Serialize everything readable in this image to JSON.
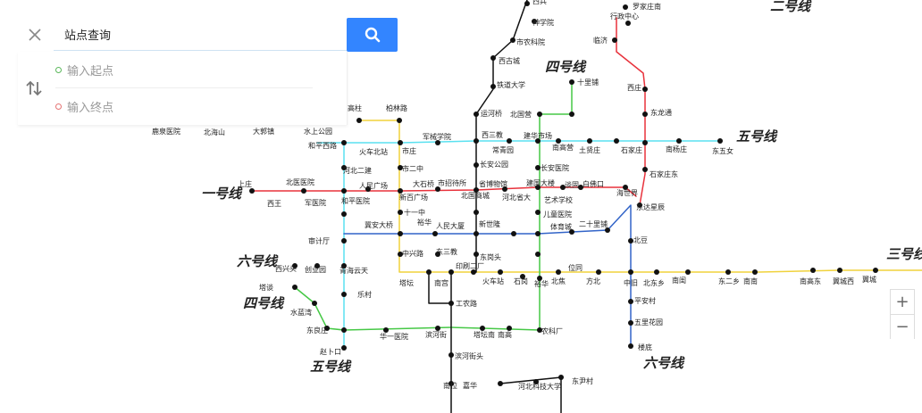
{
  "search": {
    "title": "站点查询",
    "start_placeholder": "输入起点",
    "end_placeholder": "输入终点"
  },
  "icons": {
    "close": "close-icon",
    "search": "search-icon",
    "swap": "swap-icon"
  },
  "colors": {
    "search_button": "#3385ff",
    "line1": "#e8323c",
    "line2": "#e83c3c",
    "line3": "#f0d23c",
    "line4": "#46c846",
    "line5": "#5ae1f0",
    "line6": "#3264c8"
  },
  "line_names": [
    "一号线",
    "二号线",
    "三号线",
    "四号线",
    "五号线",
    "五号线",
    "六号线",
    "六号线",
    "四号线"
  ],
  "stations": [
    "西兵",
    "神学院",
    "市农科院",
    "罗家庄南",
    "行政中心",
    "临济",
    "西古城",
    "十里铺",
    "铁道大学",
    "西庄",
    "运河桥",
    "北国营",
    "东龙通",
    "高柱",
    "柏林路",
    "二号线",
    "一号线",
    "三号线",
    "五号线",
    "鹿泉医院",
    "北海山",
    "大郭镇",
    "水上公园",
    "和平西路",
    "火车北站",
    "市庄",
    "军械学院",
    "西三教",
    "常青园",
    "建华市场",
    "南高营",
    "土贤庄",
    "石家庄",
    "南杨庄",
    "东五女",
    "河北二建",
    "长安公园",
    "市二中",
    "长安医院",
    "石家庄东",
    "上庄",
    "西王",
    "军医院",
    "北医医院",
    "和平医院",
    "人民广场",
    "大石桥",
    "新百广场",
    "市招待所",
    "北国商城",
    "河北省大",
    "省博物馆",
    "谈固",
    "建国大楼",
    "海世界",
    "白佛口",
    "艺术学校",
    "东达星辰",
    "十一中",
    "儿童医院",
    "牡丹院",
    "冀安大桥",
    "裕华",
    "人民大厦",
    "新世隆",
    "体育城",
    "二十里铺",
    "东三教",
    "北豆",
    "审计厅",
    "六号线",
    "四号线",
    "西兴头",
    "创业园",
    "青海云天",
    "中兴路",
    "东岗头",
    "孙村",
    "白佛",
    "印刷二厂",
    "塔坛",
    "南宫",
    "火车站",
    "金街村",
    "石岗",
    "裕华",
    "北焦",
    "位同",
    "方北",
    "中旧",
    "南闺",
    "北东乡",
    "东二乡",
    "南南",
    "南高东",
    "翼城西",
    "翼城",
    "翼城东",
    "乐村",
    "五里花园",
    "平安村",
    "工农路",
    "塔谈",
    "水蓝湾",
    "东良庄",
    "华一医院",
    "滨河街",
    "塔坛南",
    "南高",
    "农科厂",
    "赵卜口",
    "滨河街头",
    "南位",
    "嘉华",
    "河北科技大学",
    "东尹村",
    "楼底",
    "邮马",
    "六号线"
  ],
  "zoom": {
    "in": "+",
    "out": "−"
  }
}
